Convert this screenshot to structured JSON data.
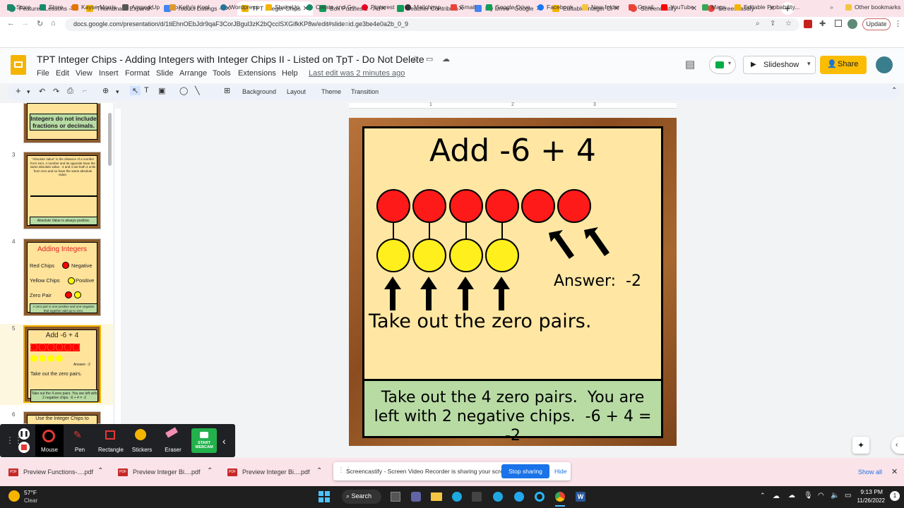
{
  "tabs": [
    {
      "label": "Featured Lessons -",
      "color": "#1a8a6a"
    },
    {
      "label": "Thumbnails Expand",
      "color": "#f4b400"
    },
    {
      "label": "Product Listings -",
      "color": "#4285f4"
    },
    {
      "label": "TPT Integer Chips",
      "color": "#f4b400"
    },
    {
      "label": "Box Puzzles 2 - Ad",
      "color": "#0f9d58"
    },
    {
      "label": "Teacher Contributo",
      "color": "#0f9d58"
    },
    {
      "label": "My Drive - Google",
      "color": "#4285f4"
    },
    {
      "label": "Editable Integer Cl",
      "color": "#f4b400"
    },
    {
      "label": "Screencastify",
      "color": "#e8453c"
    },
    {
      "label": "Screencastify",
      "color": "#e8453c"
    }
  ],
  "url": "docs.google.com/presentation/d/1tiEhnOEbJdr9qaF3CorJBgul3zK2bQcclSXGifkKP8w/edit#slide=id.ge3be4e0a2b_0_9",
  "update_label": "Update",
  "bookmarks": [
    "Store",
    "Store",
    "Kayse Morris",
    "Amped Up",
    "Kelly's Kool",
    "Wordpress",
    "ShakeUp",
    "Create and Go",
    "Pinterest",
    "Mailchimp",
    "Gmail",
    "Google Drive",
    "Facebook",
    "New folder",
    "Gmail",
    "YouTube",
    "Maps",
    "Editable Probability..."
  ],
  "other_bookmarks": "Other bookmarks",
  "doc_title": "TPT Integer Chips - Adding Integers with Integer Chips II - Listed on TpT - Do Not Delete",
  "menus": [
    "File",
    "Edit",
    "View",
    "Insert",
    "Format",
    "Slide",
    "Arrange",
    "Tools",
    "Extensions",
    "Help"
  ],
  "last_edit": "Last edit was 2 minutes ago",
  "slideshow_label": "Slideshow",
  "share_label": "Share",
  "toolbar": {
    "background": "Background",
    "layout": "Layout",
    "theme": "Theme",
    "transition": "Transition"
  },
  "ruler": [
    "1",
    "2",
    "3"
  ],
  "thumbs": {
    "n3": "3",
    "n4": "4",
    "n5": "5",
    "n6": "6",
    "t2_box": "Integers do not include fractions or decimals.",
    "t3_text": "\"Absolute Value\" is the distance of a number from zero. A number and its opposite have the same absolute value. -4 and 4 are both 4 units from zero and so have the same absolute value.",
    "t3_box": "Absolute Value is always positive.",
    "t4_title": "Adding Integers",
    "t4_red": "Red Chips",
    "t4_neg": "Negative",
    "t4_yel": "Yellow Chips",
    "t4_pos": "Positive",
    "t4_zero": "Zero Pair",
    "t4_box": "A zero pair is one positive and one negative that together add up to zero.",
    "t5_title": "Add -6 + 4",
    "t5_answer": "Answer: -2",
    "t5_take": "Take out the zero pairs.",
    "t5_box": "Take out the 4 zero pairs. You are left with 2 negative chips. -6 + 4 = -2",
    "t6_text": "Use the Integer Chips to"
  },
  "slide": {
    "title": "Add -6 + 4",
    "answer": "Answer:  -2",
    "instruction": "Take out the zero pairs.",
    "bottom": "Take out the 4 zero pairs.  You are left with 2 negative chips.  -6 + 4 = -2"
  },
  "screencastify": {
    "tools": [
      "Mouse",
      "Pen",
      "Rectangle",
      "Stickers",
      "Eraser",
      "START WEBCAM"
    ]
  },
  "downloads": [
    "Preview Functions-....pdf",
    "Preview Integer Bi....pdf",
    "Preview Integer Bi....pdf"
  ],
  "share_notice": "Screencastify - Screen Video Recorder is sharing your screen.",
  "stop_sharing": "Stop sharing",
  "hide": "Hide",
  "show_all": "Show all",
  "weather": {
    "temp": "57°F",
    "cond": "Clear"
  },
  "search_label": "Search",
  "clock": {
    "time": "9:13 PM",
    "date": "11/26/2022"
  }
}
